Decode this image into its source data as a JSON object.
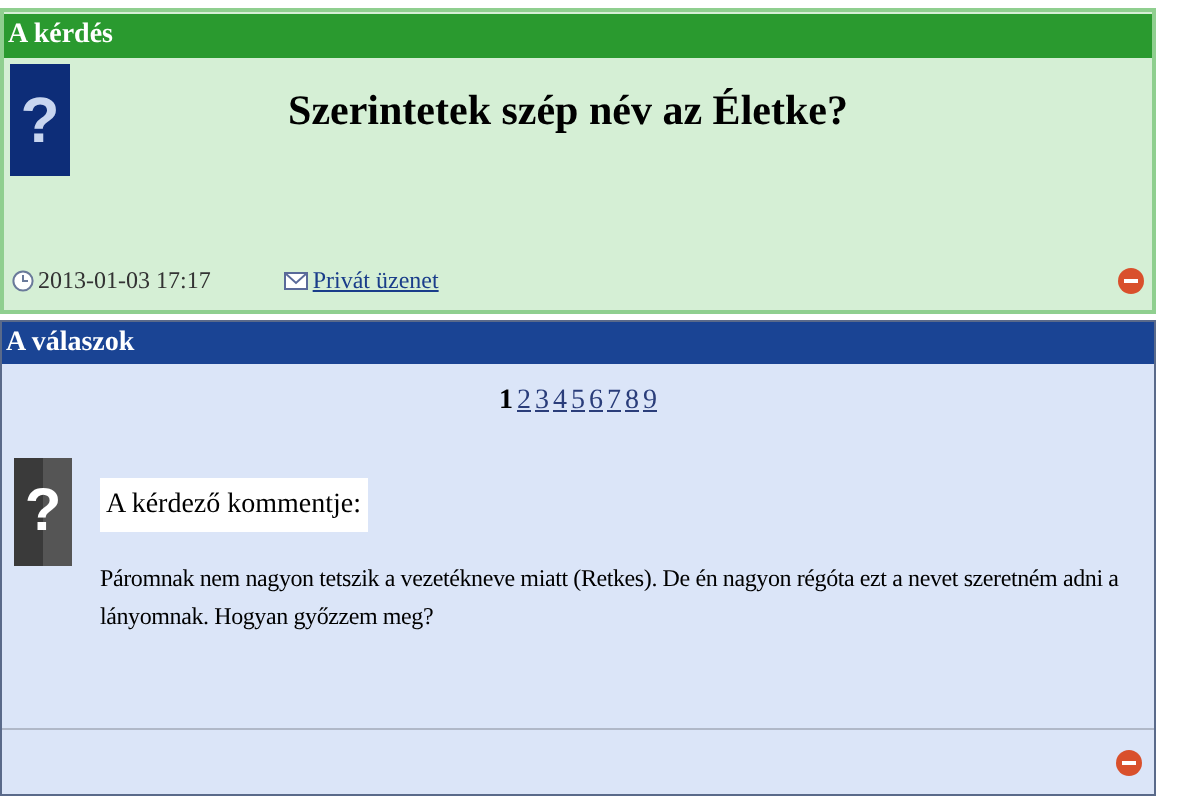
{
  "question": {
    "header": "A kérdés",
    "avatar": "?",
    "title": "Szerintetek szép név az Életke?",
    "date": "2013-01-03 17:17",
    "private_message": "Privát üzenet"
  },
  "answers": {
    "header": "A válaszok",
    "pages": [
      {
        "label": "1",
        "selected": true
      },
      {
        "label": "2",
        "selected": false
      },
      {
        "label": "3",
        "selected": false
      },
      {
        "label": "4",
        "selected": false
      },
      {
        "label": "5",
        "selected": false
      },
      {
        "label": "6",
        "selected": false
      },
      {
        "label": "7",
        "selected": false
      },
      {
        "label": "8",
        "selected": false
      },
      {
        "label": "9",
        "selected": false
      }
    ],
    "avatar": "?",
    "comment_label": "A kérdező kommentje:",
    "comment": "Páromnak nem nagyon tetszik a vezetékneve miatt (Retkes). De én nagyon régóta ezt a nevet szeretném adni a lányomnak. Hogyan győzzem meg?"
  }
}
